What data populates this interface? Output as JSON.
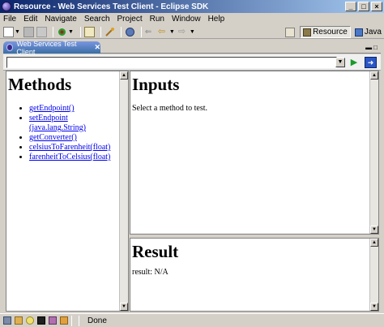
{
  "window": {
    "title": "Resource - Web Services Test Client - Eclipse SDK",
    "minimize": "_",
    "maximize": "□",
    "close": "×"
  },
  "menu": {
    "items": [
      "File",
      "Edit",
      "Navigate",
      "Search",
      "Project",
      "Run",
      "Window",
      "Help"
    ]
  },
  "perspectives": {
    "resource_label": "Resource",
    "java_label": "Java"
  },
  "editor_tab": {
    "label": "Web Services Test Client",
    "close": "✕"
  },
  "address": {
    "value": ""
  },
  "methods_frame": {
    "heading": "Methods",
    "items": [
      "getEndpoint()",
      "setEndpoint",
      "(java.lang.String)",
      "getConverter()",
      "celsiusToFarenheit(float)",
      "farenheitToCelsius(float)"
    ]
  },
  "inputs_frame": {
    "heading": "Inputs",
    "text": "Select a method to test."
  },
  "result_frame": {
    "heading": "Result",
    "text": "result: N/A"
  },
  "status": {
    "text": "Done"
  },
  "colors": {
    "titlebar_start": "#0a246a",
    "titlebar_end": "#a6caf0",
    "link": "#0000ee",
    "chrome": "#d4d0c8"
  }
}
